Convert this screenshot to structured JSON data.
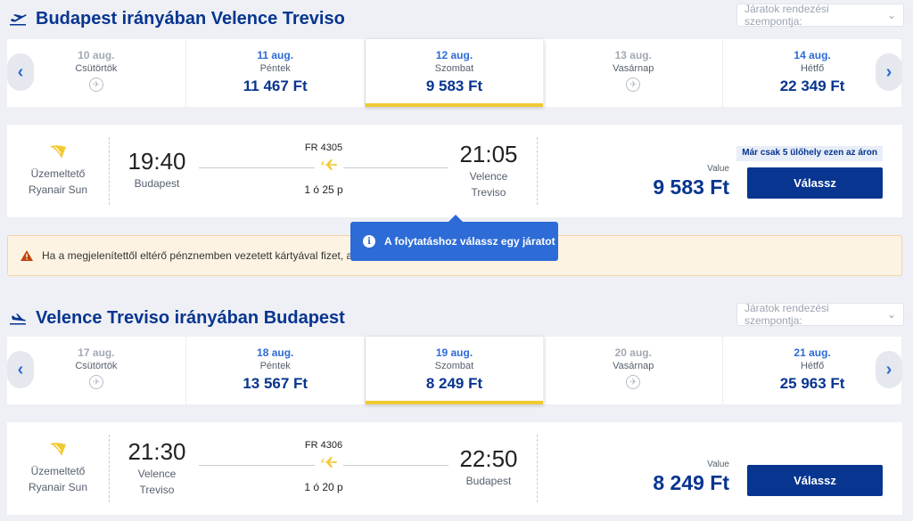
{
  "outbound": {
    "title": "Budapest irányában Velence Treviso",
    "sort_label": "Járatok rendezési szempontja:",
    "dates": [
      {
        "date": "10 aug.",
        "weekday": "Csütörtök",
        "price": "",
        "available": false,
        "selected": false
      },
      {
        "date": "11 aug.",
        "weekday": "Péntek",
        "price": "11 467 Ft",
        "available": true,
        "selected": false
      },
      {
        "date": "12 aug.",
        "weekday": "Szombat",
        "price": "9 583 Ft",
        "available": true,
        "selected": true
      },
      {
        "date": "13 aug.",
        "weekday": "Vasárnap",
        "price": "",
        "available": false,
        "selected": false
      },
      {
        "date": "14 aug.",
        "weekday": "Hétfő",
        "price": "22 349 Ft",
        "available": true,
        "selected": false
      }
    ],
    "flight": {
      "operator_label": "Üzemeltető",
      "operator_name": "Ryanair Sun",
      "dep_time": "19:40",
      "dep_city_1": "Budapest",
      "dep_city_2": "",
      "flight_number": "FR 4305",
      "duration": "1 ó 25 p",
      "arr_time": "21:05",
      "arr_city_1": "Velence",
      "arr_city_2": "Treviso",
      "seat_badge": "Már csak 5 ülőhely ezen az áron",
      "price_label": "Value",
      "price": "9 583 Ft",
      "button_label": "Válassz"
    }
  },
  "warning_text": "Ha a megjelenítettől eltérő pénznemben vezetett kártyával fizet, a",
  "tooltip_text": "A folytatáshoz válassz egy járatot",
  "return": {
    "title": "Velence Treviso irányában Budapest",
    "sort_label": "Járatok rendezési szempontja:",
    "dates": [
      {
        "date": "17 aug.",
        "weekday": "Csütörtök",
        "price": "",
        "available": false,
        "selected": false
      },
      {
        "date": "18 aug.",
        "weekday": "Péntek",
        "price": "13 567 Ft",
        "available": true,
        "selected": false
      },
      {
        "date": "19 aug.",
        "weekday": "Szombat",
        "price": "8 249 Ft",
        "available": true,
        "selected": true
      },
      {
        "date": "20 aug.",
        "weekday": "Vasárnap",
        "price": "",
        "available": false,
        "selected": false
      },
      {
        "date": "21 aug.",
        "weekday": "Hétfő",
        "price": "25 963 Ft",
        "available": true,
        "selected": false
      }
    ],
    "flight": {
      "operator_label": "Üzemeltető",
      "operator_name": "Ryanair Sun",
      "dep_time": "21:30",
      "dep_city_1": "Velence",
      "dep_city_2": "Treviso",
      "flight_number": "FR 4306",
      "duration": "1 ó 20 p",
      "arr_time": "22:50",
      "arr_city_1": "Budapest",
      "arr_city_2": "",
      "price_label": "Value",
      "price": "8 249 Ft",
      "button_label": "Válassz"
    }
  },
  "colors": {
    "brand": "#073590",
    "accent": "#f1c933",
    "link": "#2d6bd6"
  }
}
